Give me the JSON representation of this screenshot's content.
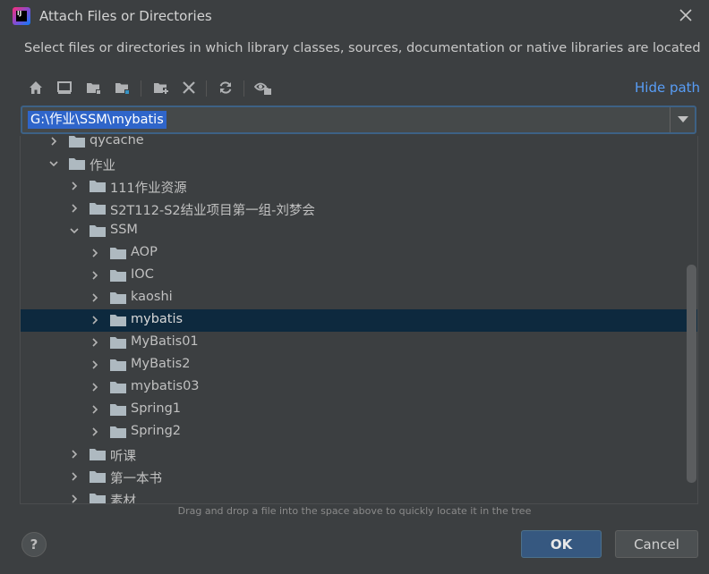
{
  "window": {
    "title": "Attach Files or Directories",
    "app_icon": "intellij-icon"
  },
  "description": "Select files or directories in which library classes, sources, documentation or native libraries are located",
  "toolbar": {
    "buttons": [
      {
        "name": "home-icon"
      },
      {
        "name": "desktop-icon"
      },
      {
        "name": "project-folder-icon"
      },
      {
        "name": "module-folder-icon"
      },
      {
        "name": "new-folder-icon"
      },
      {
        "name": "delete-icon"
      },
      {
        "name": "refresh-icon"
      },
      {
        "name": "show-hidden-icon"
      }
    ],
    "hide_path_label": "Hide path"
  },
  "path": {
    "value": "G:\\作业\\SSM\\mybatis"
  },
  "tree": {
    "items": [
      {
        "label": "qycache",
        "depth": 1,
        "expanded": false,
        "selected": false
      },
      {
        "label": "作业",
        "depth": 1,
        "expanded": true,
        "selected": false
      },
      {
        "label": "111作业资源",
        "depth": 2,
        "expanded": false,
        "selected": false
      },
      {
        "label": "S2T112-S2结业项目第一组-刘梦会",
        "depth": 2,
        "expanded": false,
        "selected": false
      },
      {
        "label": "SSM",
        "depth": 2,
        "expanded": true,
        "selected": false
      },
      {
        "label": "AOP",
        "depth": 3,
        "expanded": false,
        "selected": false
      },
      {
        "label": "IOC",
        "depth": 3,
        "expanded": false,
        "selected": false
      },
      {
        "label": "kaoshi",
        "depth": 3,
        "expanded": false,
        "selected": false
      },
      {
        "label": "mybatis",
        "depth": 3,
        "expanded": false,
        "selected": true
      },
      {
        "label": "MyBatis01",
        "depth": 3,
        "expanded": false,
        "selected": false
      },
      {
        "label": "MyBatis2",
        "depth": 3,
        "expanded": false,
        "selected": false
      },
      {
        "label": "mybatis03",
        "depth": 3,
        "expanded": false,
        "selected": false
      },
      {
        "label": "Spring1",
        "depth": 3,
        "expanded": false,
        "selected": false
      },
      {
        "label": "Spring2",
        "depth": 3,
        "expanded": false,
        "selected": false
      },
      {
        "label": "听课",
        "depth": 2,
        "expanded": false,
        "selected": false
      },
      {
        "label": "第一本书",
        "depth": 2,
        "expanded": false,
        "selected": false
      },
      {
        "label": "素材",
        "depth": 2,
        "expanded": false,
        "selected": false
      }
    ]
  },
  "hint": "Drag and drop a file into the space above to quickly locate it in the tree",
  "buttons": {
    "help_label": "?",
    "ok_label": "OK",
    "cancel_label": "Cancel"
  },
  "colors": {
    "background": "#3c3f41",
    "selection": "#0d293e",
    "link": "#589df6",
    "path_highlight": "#2f65ca",
    "ok_button": "#365880"
  }
}
